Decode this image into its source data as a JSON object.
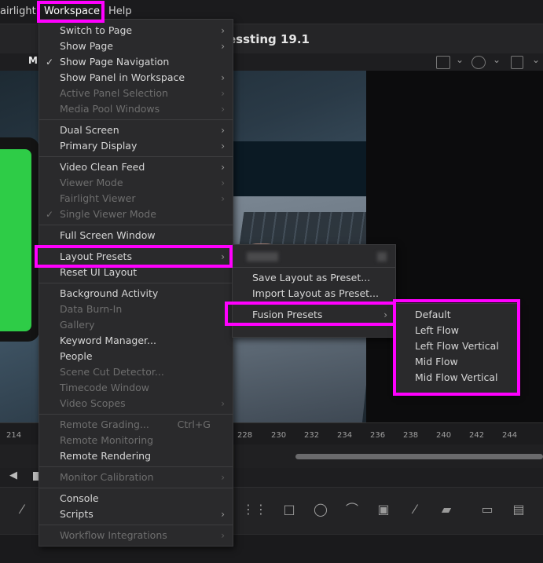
{
  "menubar": {
    "items": [
      "airlight",
      "Workspace",
      "Help"
    ]
  },
  "titlebar": {
    "title": "essting 19.1"
  },
  "viewer": {
    "mode_label": "M"
  },
  "ruler": {
    "ticks": [
      "214",
      "228",
      "230",
      "232",
      "234",
      "236",
      "238",
      "240",
      "242",
      "244"
    ]
  },
  "workspace_menu": {
    "items": [
      {
        "label": "Switch to Page",
        "enabled": true,
        "submenu": true
      },
      {
        "label": "Show Page",
        "enabled": true,
        "submenu": true
      },
      {
        "label": "Show Page Navigation",
        "enabled": true,
        "checked": true
      },
      {
        "label": "Show Panel in Workspace",
        "enabled": true,
        "submenu": true
      },
      {
        "label": "Active Panel Selection",
        "enabled": false,
        "submenu": true
      },
      {
        "label": "Media Pool Windows",
        "enabled": false,
        "submenu": true
      },
      {
        "label": "Dual Screen",
        "enabled": true,
        "submenu": true
      },
      {
        "label": "Primary Display",
        "enabled": true,
        "submenu": true
      },
      {
        "label": "Video Clean Feed",
        "enabled": true,
        "submenu": true
      },
      {
        "label": "Viewer Mode",
        "enabled": false,
        "submenu": true
      },
      {
        "label": "Fairlight Viewer",
        "enabled": false,
        "submenu": true
      },
      {
        "label": "Single Viewer Mode",
        "enabled": false,
        "checked": true
      },
      {
        "label": "Full Screen Window",
        "enabled": true
      },
      {
        "label": "Layout Presets",
        "enabled": true,
        "submenu": true,
        "highlighted": true
      },
      {
        "label": "Reset UI Layout",
        "enabled": true
      },
      {
        "label": "Background Activity",
        "enabled": true
      },
      {
        "label": "Data Burn-In",
        "enabled": false
      },
      {
        "label": "Gallery",
        "enabled": false
      },
      {
        "label": "Keyword Manager...",
        "enabled": true
      },
      {
        "label": "People",
        "enabled": true
      },
      {
        "label": "Scene Cut Detector...",
        "enabled": false
      },
      {
        "label": "Timecode Window",
        "enabled": false
      },
      {
        "label": "Video Scopes",
        "enabled": false,
        "submenu": true
      },
      {
        "label": "Remote Grading...",
        "enabled": false,
        "shortcut": "Ctrl+G"
      },
      {
        "label": "Remote Monitoring",
        "enabled": false
      },
      {
        "label": "Remote Rendering",
        "enabled": true
      },
      {
        "label": "Monitor Calibration",
        "enabled": false,
        "submenu": true
      },
      {
        "label": "Console",
        "enabled": true
      },
      {
        "label": "Scripts",
        "enabled": true,
        "submenu": true
      },
      {
        "label": "Workflow Integrations",
        "enabled": false,
        "submenu": true
      }
    ]
  },
  "layout_presets_submenu": {
    "items": [
      "Save Layout as Preset...",
      "Import Layout as Preset...",
      "Fusion Presets"
    ]
  },
  "fusion_presets_submenu": {
    "items": [
      "Default",
      "Left Flow",
      "Left Flow Vertical",
      "Mid Flow",
      "Mid Flow Vertical"
    ]
  },
  "colors": {
    "highlight": "#ff00ff",
    "phone_screen": "#2ecc47"
  }
}
